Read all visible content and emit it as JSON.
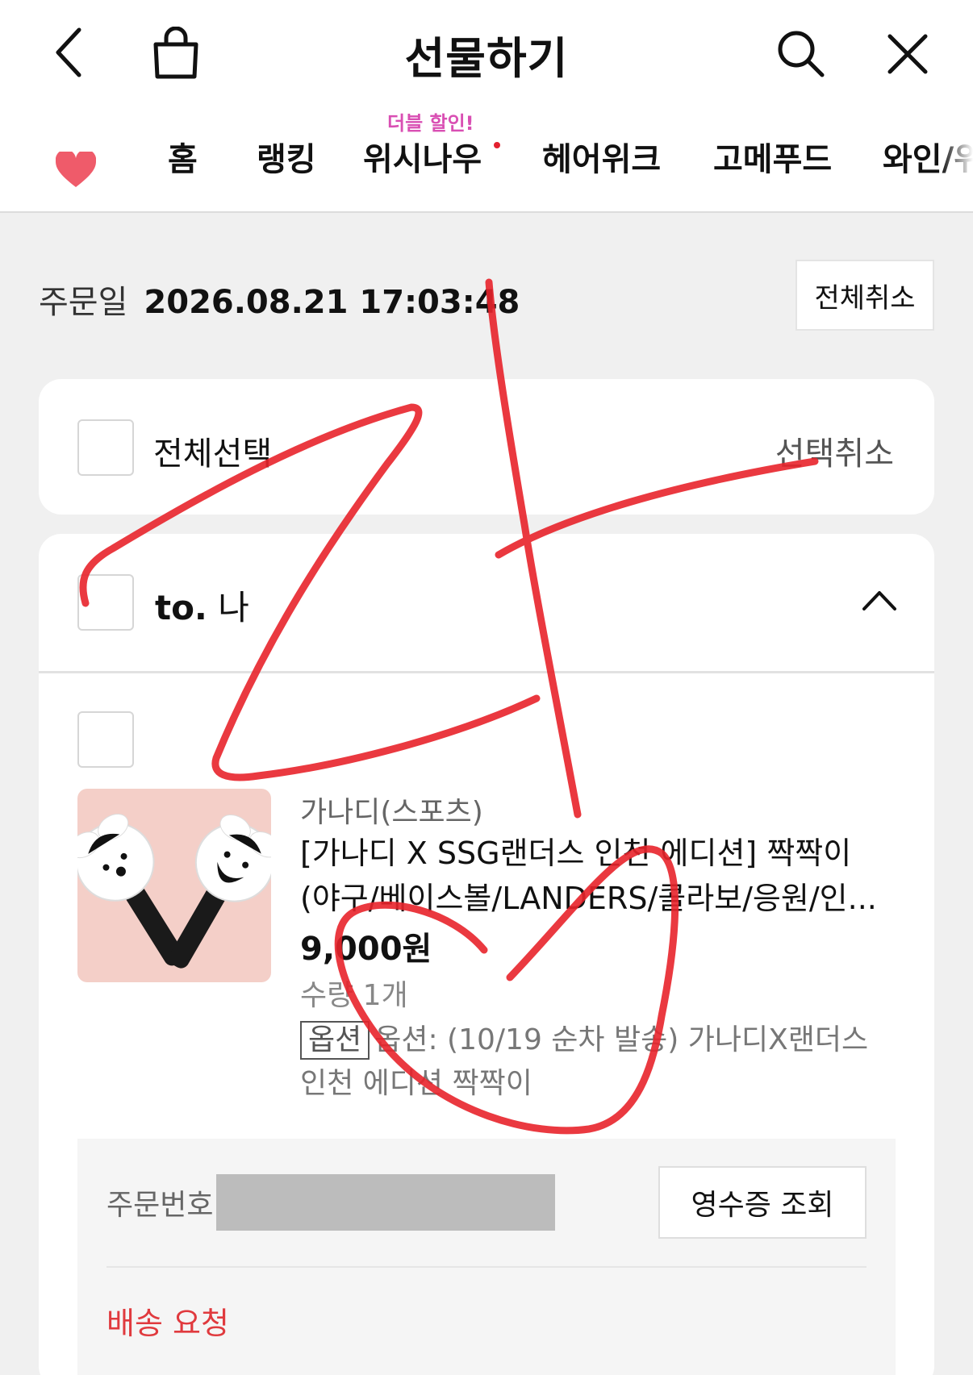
{
  "header": {
    "title": "선물하기",
    "icons": {
      "back": "chevron-left-icon",
      "bag": "shopping-bag-icon",
      "search": "search-icon",
      "close": "close-icon",
      "wish": "heart-icon"
    }
  },
  "nav": {
    "badge": "더블 할인!",
    "tabs": [
      "홈",
      "랭킹",
      "위시나우",
      "헤어위크",
      "고메푸드",
      "와인/위"
    ]
  },
  "order": {
    "date_label": "주문일",
    "date_value": "2026.08.21 17:03:48",
    "cancel_all": "전체취소",
    "select_all": "전체선택",
    "deselect": "선택취소",
    "recipient_prefix": "to.",
    "recipient_name": "나"
  },
  "product": {
    "brand": "가나디(스포츠)",
    "name": "[가나디 X SSG랜더스 인천 에디션] 짝짝이 (야구/베이스볼/LANDERS/콜라보/응원/인...",
    "price": "9,000원",
    "quantity": "수량 1개",
    "option_badge": "옵션",
    "option_text": "옵션: (10/19 순차 발송) 가나디X랜더스 인천 에디션 짝짝이"
  },
  "order_info": {
    "order_no_label": "주문번호",
    "receipt_button": "영수증 조회",
    "delivery_request": "배송 요청"
  },
  "colors": {
    "accent_pink": "#d94fb3",
    "heart": "#ef5b6a",
    "delivery_red": "#e03a3e",
    "scribble_red": "#e8232b"
  }
}
